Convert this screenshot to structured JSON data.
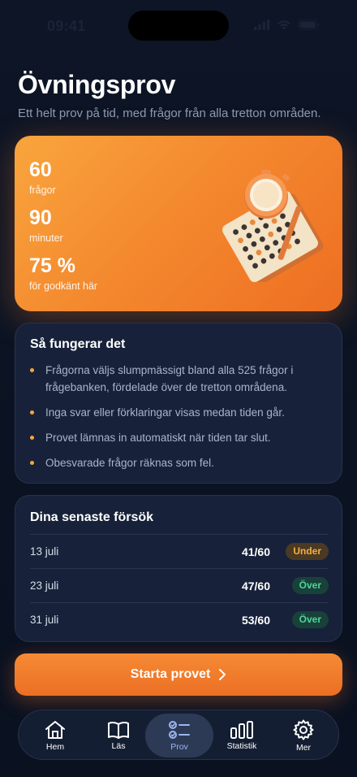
{
  "status": {
    "time": "09:41"
  },
  "header": {
    "title": "Övningsprov",
    "subtitle": "Ett helt prov på tid, med frågor från alla tretton områden."
  },
  "hero": {
    "stats": [
      {
        "value": "60",
        "label": "frågor"
      },
      {
        "value": "90",
        "label": "minuter"
      },
      {
        "value": "75 %",
        "label": "för godkänt här"
      }
    ],
    "illustration": "timer-and-answer-sheet-icon"
  },
  "info": {
    "title": "Så fungerar det",
    "bullets": [
      "Frågorna väljs slumpmässigt bland alla 525 frågor i frågebanken, fördelade över de tretton områdena.",
      "Inga svar eller förklaringar visas medan tiden går.",
      "Provet lämnas in automatiskt när tiden tar slut.",
      "Obesvarade frågor räknas som fel."
    ]
  },
  "attempts": {
    "title": "Dina senaste försök",
    "rows": [
      {
        "date": "13 juli",
        "score": "41/60",
        "status": "Under"
      },
      {
        "date": "23 juli",
        "score": "47/60",
        "status": "Över"
      },
      {
        "date": "31 juli",
        "score": "53/60",
        "status": "Över"
      }
    ]
  },
  "start_button": {
    "label": "Starta provet"
  },
  "tabbar": {
    "tabs": [
      {
        "label": "Hem",
        "icon": "home-icon"
      },
      {
        "label": "Läs",
        "icon": "book-icon"
      },
      {
        "label": "Prov",
        "icon": "checklist-icon",
        "active": true
      },
      {
        "label": "Statistik",
        "icon": "bar-chart-icon"
      },
      {
        "label": "Mer",
        "icon": "gear-icon"
      }
    ]
  },
  "colors": {
    "accent": "#f48a2f",
    "background": "#0d1526",
    "card": "#17223a",
    "under": "#f5ad45",
    "over": "#4fd49a"
  }
}
